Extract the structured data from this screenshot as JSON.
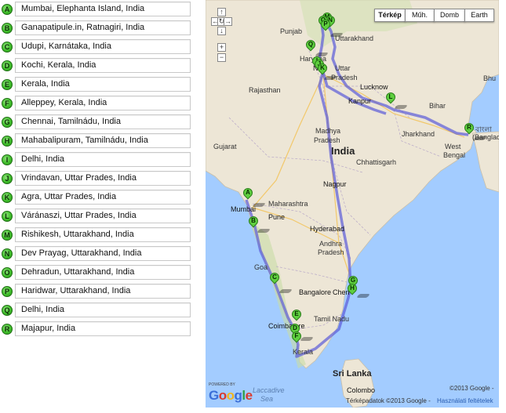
{
  "waypoints": [
    {
      "letter": "A",
      "address": "Mumbai, Elephanta Island, India"
    },
    {
      "letter": "B",
      "address": "Ganapatipule.in, Ratnagiri, India"
    },
    {
      "letter": "C",
      "address": "Udupi, Karnátaka, India"
    },
    {
      "letter": "D",
      "address": "Kochi, Kerala, India"
    },
    {
      "letter": "E",
      "address": "Kerala, India"
    },
    {
      "letter": "F",
      "address": "Alleppey, Kerala, India"
    },
    {
      "letter": "G",
      "address": "Chennai, Tamilnádu, India"
    },
    {
      "letter": "H",
      "address": "Mahabalipuram, Tamilnádu, India"
    },
    {
      "letter": "I",
      "address": "Delhi, India"
    },
    {
      "letter": "J",
      "address": "Vrindavan, Uttar Prades, India"
    },
    {
      "letter": "K",
      "address": "Agra, Uttar Prades, India"
    },
    {
      "letter": "L",
      "address": "Váránaszi, Uttar Prades, India"
    },
    {
      "letter": "M",
      "address": "Rishikesh, Uttarakhand, India"
    },
    {
      "letter": "N",
      "address": "Dev Prayag, Uttarakhand, India"
    },
    {
      "letter": "O",
      "address": "Dehradun, Uttarakhand, India"
    },
    {
      "letter": "P",
      "address": "Haridwar, Uttarakhand, India"
    },
    {
      "letter": "Q",
      "address": "Delhi, India"
    },
    {
      "letter": "R",
      "address": "Majapur, India"
    }
  ],
  "map": {
    "map_types": [
      "Térkép",
      "Műh.",
      "Domb",
      "Earth"
    ],
    "active_type": "Térkép",
    "pan_labels": {
      "up": "↑",
      "left": "←",
      "center": "↻",
      "right": "→",
      "down": "↓"
    },
    "zoom_labels": {
      "in": "+",
      "out": "−"
    },
    "labels": {
      "uttarakhand": "Uttarakhand",
      "punjab": "Punjab",
      "haryana": "Haryana",
      "new_delhi": "New",
      "rajasthan": "Rajasthan",
      "uttar": "Uttar",
      "pradesh_up": "Pradesh",
      "lucknow": "Lucknow",
      "kanpur": "Kanpur",
      "bihar": "Bihar",
      "madhya": "Madhya",
      "pradesh_mp": "Pradesh",
      "gujarat": "Gujarat",
      "india": "India",
      "jharkhand": "Jharkhand",
      "west_bengal_1": "West",
      "west_bengal_2": "Bengal",
      "chhattisgarh": "Chhattisgarh",
      "maharashtra": "Maharashtra",
      "mumbai": "Mumbai",
      "pune": "Pune",
      "nagpur": "Nagpur",
      "hyderabad": "Hyderabad",
      "andhra": "Andhra",
      "pradesh_ap": "Pradesh",
      "goa": "Goa",
      "bangalore": "Bangalore",
      "chennai": "Chen",
      "tamil_nadu": "Tamil Nadu",
      "coimbatore": "Coimbatore",
      "kerala": "Kerala",
      "sri_lanka": "Sri Lanka",
      "colombo": "Colombo",
      "laccadive_1": "Laccadive",
      "laccadive_2": "Sea",
      "bhutan": "Bhu",
      "bangladesh": "বাংলা",
      "bangladesh_2": "(Banglad"
    },
    "powered_by": "POWERED BY",
    "logo": {
      "g1": "G",
      "o1": "o",
      "o2": "o",
      "g2": "g",
      "l": "l",
      "e": "e"
    },
    "copyright": "©2013 Google -",
    "map_data_text": "Térképadatok ©2013 Google -",
    "terms_link": "Használati feltételek"
  }
}
